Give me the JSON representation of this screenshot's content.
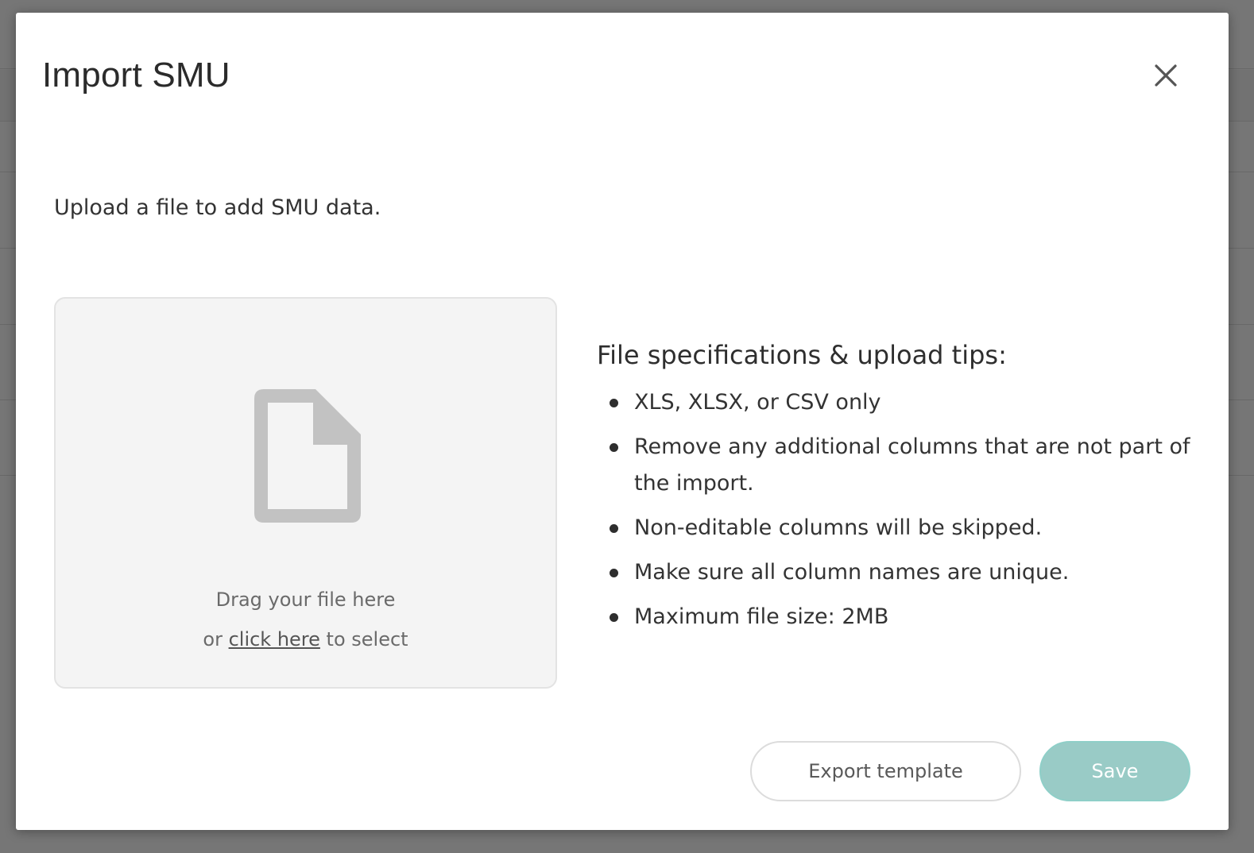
{
  "modal": {
    "title": "Import SMU",
    "intro": "Upload a file to add SMU data."
  },
  "dropzone": {
    "line1": "Drag your file here",
    "line2_prefix": "or ",
    "line2_link": "click here",
    "line2_suffix": " to select",
    "icon": "file-icon"
  },
  "specs": {
    "title": "File specifications & upload tips:",
    "items": [
      "XLS, XLSX, or CSV only",
      "Remove any additional columns that are not part of the import.",
      "Non-editable columns will be skipped.",
      "Make sure all column names are unique.",
      "Maximum file size: 2MB"
    ]
  },
  "buttons": {
    "export_label": "Export template",
    "save_label": "Save"
  },
  "colors": {
    "save_bg": "#99cbc6",
    "overlay": "rgba(40,40,40,0.62)"
  }
}
